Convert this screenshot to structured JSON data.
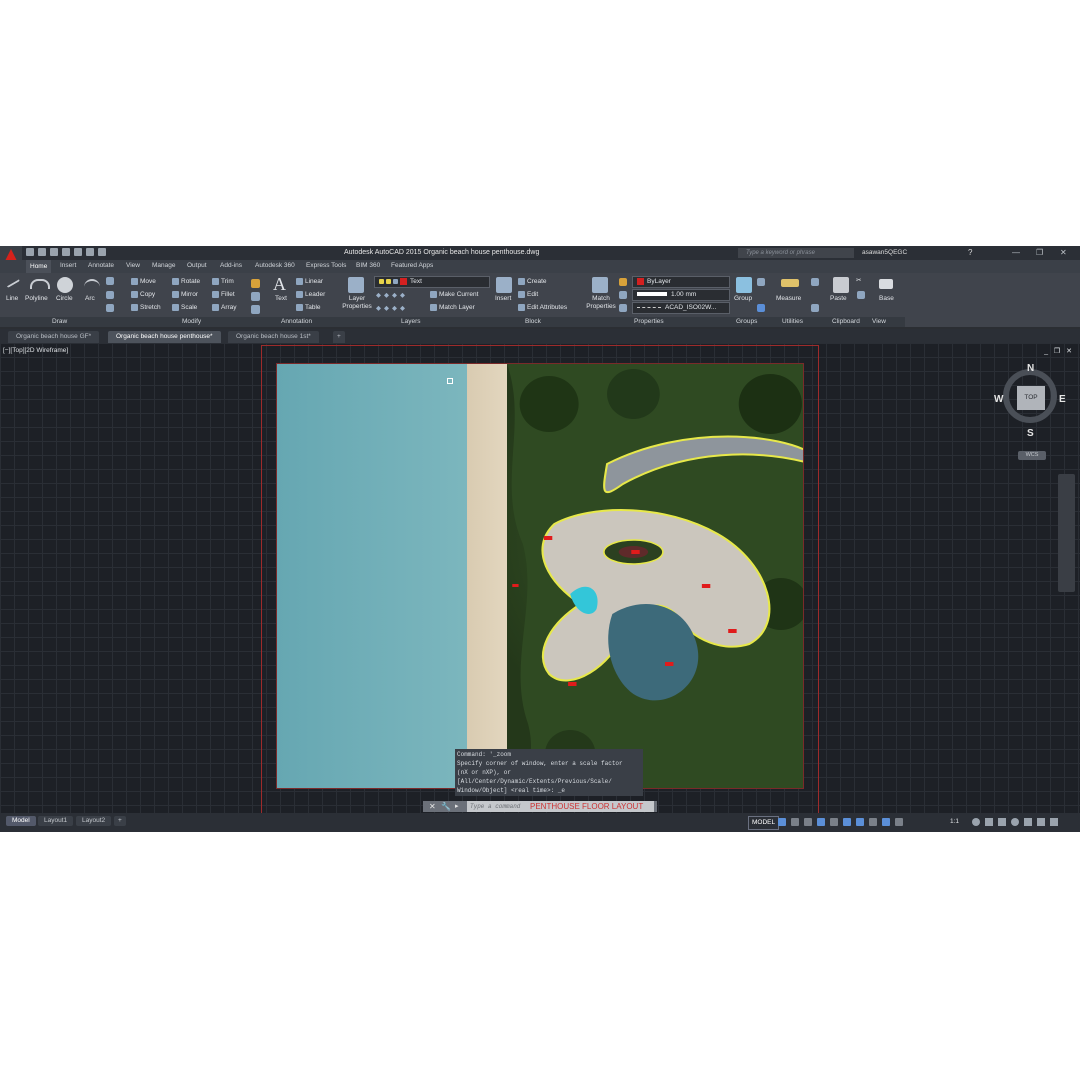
{
  "app": {
    "title": "Autodesk AutoCAD 2015    Organic beach house penthouse.dwg",
    "search_placeholder": "Type a keyword or phrase",
    "user": "asawan5QEGC",
    "help": "?",
    "window_controls": [
      "—",
      "❐",
      "✕"
    ]
  },
  "ribbon_tabs": [
    "Home",
    "Insert",
    "Annotate",
    "View",
    "Manage",
    "Output",
    "Add-ins",
    "Autodesk 360",
    "Express Tools",
    "BIM 360",
    "Featured Apps"
  ],
  "ribbon": {
    "draw": [
      "Line",
      "Polyline",
      "Circle",
      "Arc"
    ],
    "modify": [
      [
        "Move",
        "Rotate",
        "Trim"
      ],
      [
        "Copy",
        "Mirror",
        "Fillet"
      ],
      [
        "Stretch",
        "Scale",
        "Array"
      ]
    ],
    "text_label": "Text",
    "annotation_items": [
      "Linear",
      "Leader",
      "Table"
    ],
    "layer_properties": "Layer Properties",
    "layer_current": "Text",
    "layer_actions": [
      "Make Current",
      "Match Layer"
    ],
    "insert_label": "Insert",
    "block_items": [
      "Create",
      "Edit",
      "Edit Attributes"
    ],
    "match_properties": "Match Properties",
    "bylayer": "ByLayer",
    "lineweight": "1.00 mm",
    "linetype": "ACAD_ISO02W...",
    "group_label": "Group",
    "measure_label": "Measure",
    "paste_label": "Paste",
    "base_label": "Base",
    "panel_labels": [
      "Draw",
      "Modify",
      "Annotation",
      "Layers",
      "Block",
      "Properties",
      "Groups",
      "Utilities",
      "Clipboard",
      "View"
    ]
  },
  "file_tabs": [
    "Organic beach house GF*",
    "Organic beach house penthouse*",
    "Organic beach house 1st*",
    "+"
  ],
  "viewport": {
    "label": "[−][Top][2D Wireframe]",
    "controls": "_ ❐ ✕",
    "plan_title": "PENTHOUSE FLOOR LAYOUT"
  },
  "viewcube": {
    "north": "N",
    "south": "S",
    "east": "E",
    "west": "W",
    "face": "TOP",
    "wcs": "WCS"
  },
  "command": {
    "history": [
      "Command: '_zoom",
      "Specify corner of window, enter a scale factor",
      "(nX or nXP), or",
      "[All/Center/Dynamic/Extents/Previous/Scale/",
      "Window/Object] <real time>: _e"
    ],
    "placeholder": "Type a command"
  },
  "status": {
    "layout_tabs": [
      "Model",
      "Layout1",
      "Layout2",
      "+"
    ],
    "model_button": "MODEL",
    "scale": "1:1"
  },
  "colors": {
    "accent": "#5b8fd8",
    "autocad_red": "#d6221b"
  }
}
